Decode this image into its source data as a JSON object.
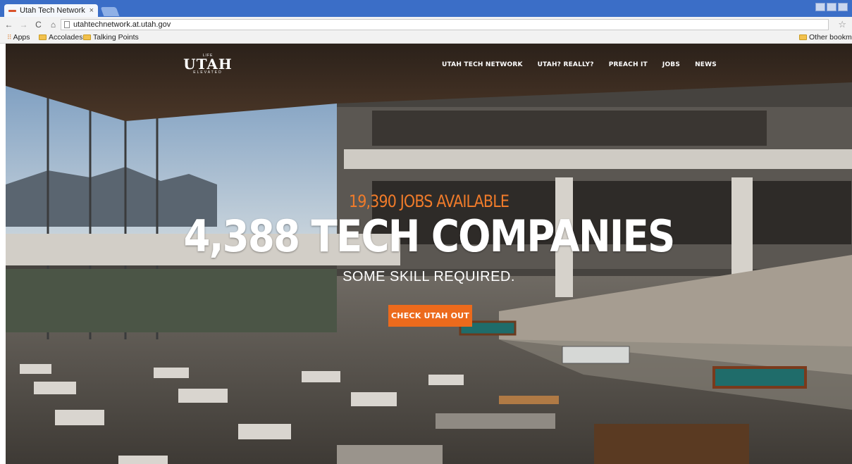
{
  "browser": {
    "tab_title": "Utah Tech Network |",
    "tab_close": "×",
    "url": "utahtechnetwork.at.utah.gov",
    "bookmarks": [
      {
        "label": "Apps",
        "icon": "apps-icon"
      },
      {
        "label": "Accolades",
        "icon": "folder-icon"
      },
      {
        "label": "Talking Points",
        "icon": "folder-icon"
      }
    ],
    "other_bookmarks": "Other bookma"
  },
  "logo": {
    "top": "LIFE",
    "name": "UTAH",
    "tagline": "ELEVATED"
  },
  "nav": {
    "items": [
      "UTAH TECH NETWORK",
      "UTAH? REALLY?",
      "PREACH IT",
      "JOBS",
      "NEWS"
    ]
  },
  "hero": {
    "jobs_line": "19,390 JOBS AVAILABLE",
    "headline": "4,388 TECH COMPANIES",
    "subline": "SOME SKILL REQUIRED.",
    "cta_label": "CHECK UTAH OUT"
  },
  "colors": {
    "accent": "#ec6a1c",
    "jobs_text": "#f07b2a",
    "tabstrip": "#3b6ec7"
  }
}
